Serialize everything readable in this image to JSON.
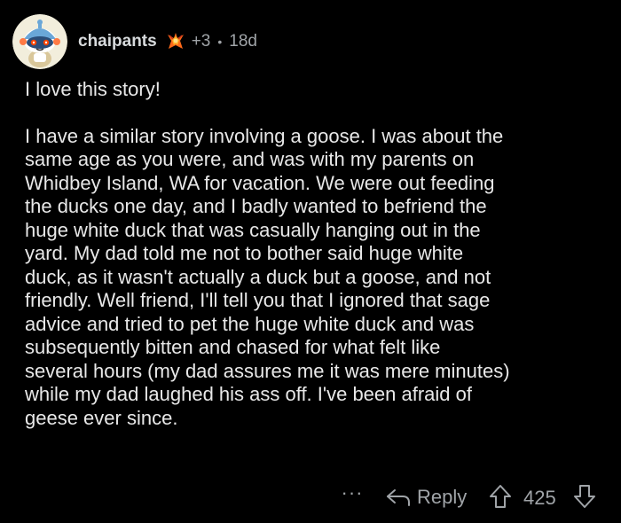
{
  "comment": {
    "author": "chaipants",
    "award_count": "+3",
    "separator": "•",
    "age": "18d",
    "avatar_icon": "snoo-avatar-icon",
    "award_icon": "award-icon",
    "paragraphs": [
      "I love this story!",
      "I have a similar story involving a goose.  I was about the\nsame age as you were, and was with my parents on\nWhidbey Island, WA for vacation.  We were out feeding\nthe ducks one day, and I badly wanted to befriend the\nhuge white duck that was casually hanging out in the\nyard.  My dad told me not to bother said huge white\nduck, as it wasn't actually a duck but a goose, and not\nfriendly.  Well friend, I'll tell you that I ignored that sage\nadvice and tried to pet the huge white duck and was\nsubsequently bitten and chased for what felt like\nseveral hours (my dad assures me it was mere minutes)\nwhile my dad laughed his ass off.  I've been afraid of\ngeese ever since."
    ]
  },
  "actions": {
    "more": "···",
    "reply_label": "Reply",
    "score": "425"
  },
  "colors": {
    "background": "#000000",
    "text": "#e8e8e8",
    "muted": "#a0a4a8"
  }
}
